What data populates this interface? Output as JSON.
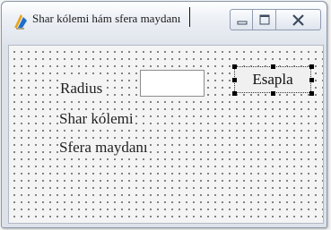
{
  "window": {
    "title": "Shar kólemi hám sfera maydanı"
  },
  "form": {
    "radius_label": "Radius",
    "radius_value": "",
    "button_label": "Esapla",
    "volume_label": "Shar kólemi",
    "area_label": "Sfera maydanı"
  },
  "icons": {
    "app": "app-icon",
    "minimize": "minimize-icon",
    "maximize": "maximize-icon",
    "close": "close-icon"
  },
  "colors": {
    "icon_blue": "#1e6ec9",
    "icon_orange": "#e8a31c"
  }
}
